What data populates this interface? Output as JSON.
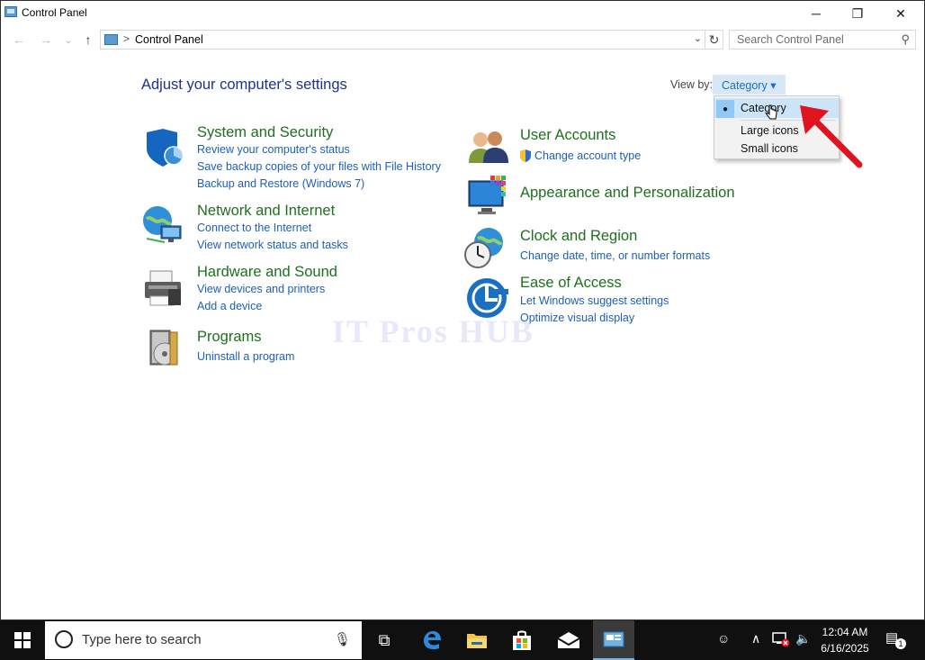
{
  "window": {
    "title": "Control Panel",
    "minimize_glyph": "─",
    "maximize_glyph": "❐",
    "close_glyph": "✕"
  },
  "addressbar": {
    "back_glyph": "←",
    "forward_glyph": "→",
    "recent_glyph": "⌄",
    "up_glyph": "↑",
    "separator": ">",
    "path": "Control Panel",
    "dropdown_glyph": "⌄",
    "refresh_glyph": "↻",
    "search_placeholder": "Search Control Panel",
    "search_icon_glyph": "⚲"
  },
  "main": {
    "heading": "Adjust your computer's settings",
    "view_by_label": "View by:",
    "view_by_value": "Category ▾"
  },
  "categories_left": [
    {
      "title": "System and Security",
      "links": [
        "Review your computer's status",
        "Save backup copies of your files with File History",
        "Backup and Restore (Windows 7)"
      ]
    },
    {
      "title": "Network and Internet",
      "links": [
        "Connect to the Internet",
        "View network status and tasks"
      ]
    },
    {
      "title": "Hardware and Sound",
      "links": [
        "View devices and printers",
        "Add a device"
      ]
    },
    {
      "title": "Programs",
      "links": [
        "Uninstall a program"
      ]
    }
  ],
  "categories_right": [
    {
      "title": "User Accounts",
      "links": [
        "Change account type"
      ]
    },
    {
      "title": "Appearance and Personalization",
      "links": []
    },
    {
      "title": "Clock and Region",
      "links": [
        "Change date, time, or number formats"
      ]
    },
    {
      "title": "Ease of Access",
      "links": [
        "Let Windows suggest settings",
        "Optimize visual display"
      ]
    }
  ],
  "dropdown": {
    "options": [
      "Category",
      "Large icons",
      "Small icons"
    ],
    "selected_index": 0,
    "check_glyph": "●"
  },
  "watermark": "IT Pros HUB",
  "taskbar": {
    "search_placeholder": "Type here to search",
    "mic_glyph": "🎙",
    "task_view_glyph": "⧉",
    "tray": {
      "people_glyph": "☺",
      "chevron_glyph": "∧",
      "volume_glyph": "🔈",
      "time": "12:04 AM",
      "date": "6/16/2025",
      "notification_glyph": "▤",
      "notification_count": "1"
    }
  },
  "colors": {
    "heading": "#1e3287",
    "category_title": "#1f6f1f",
    "link": "#1d5fb7",
    "arrow": "#e0141e",
    "taskbar": "#101010"
  }
}
